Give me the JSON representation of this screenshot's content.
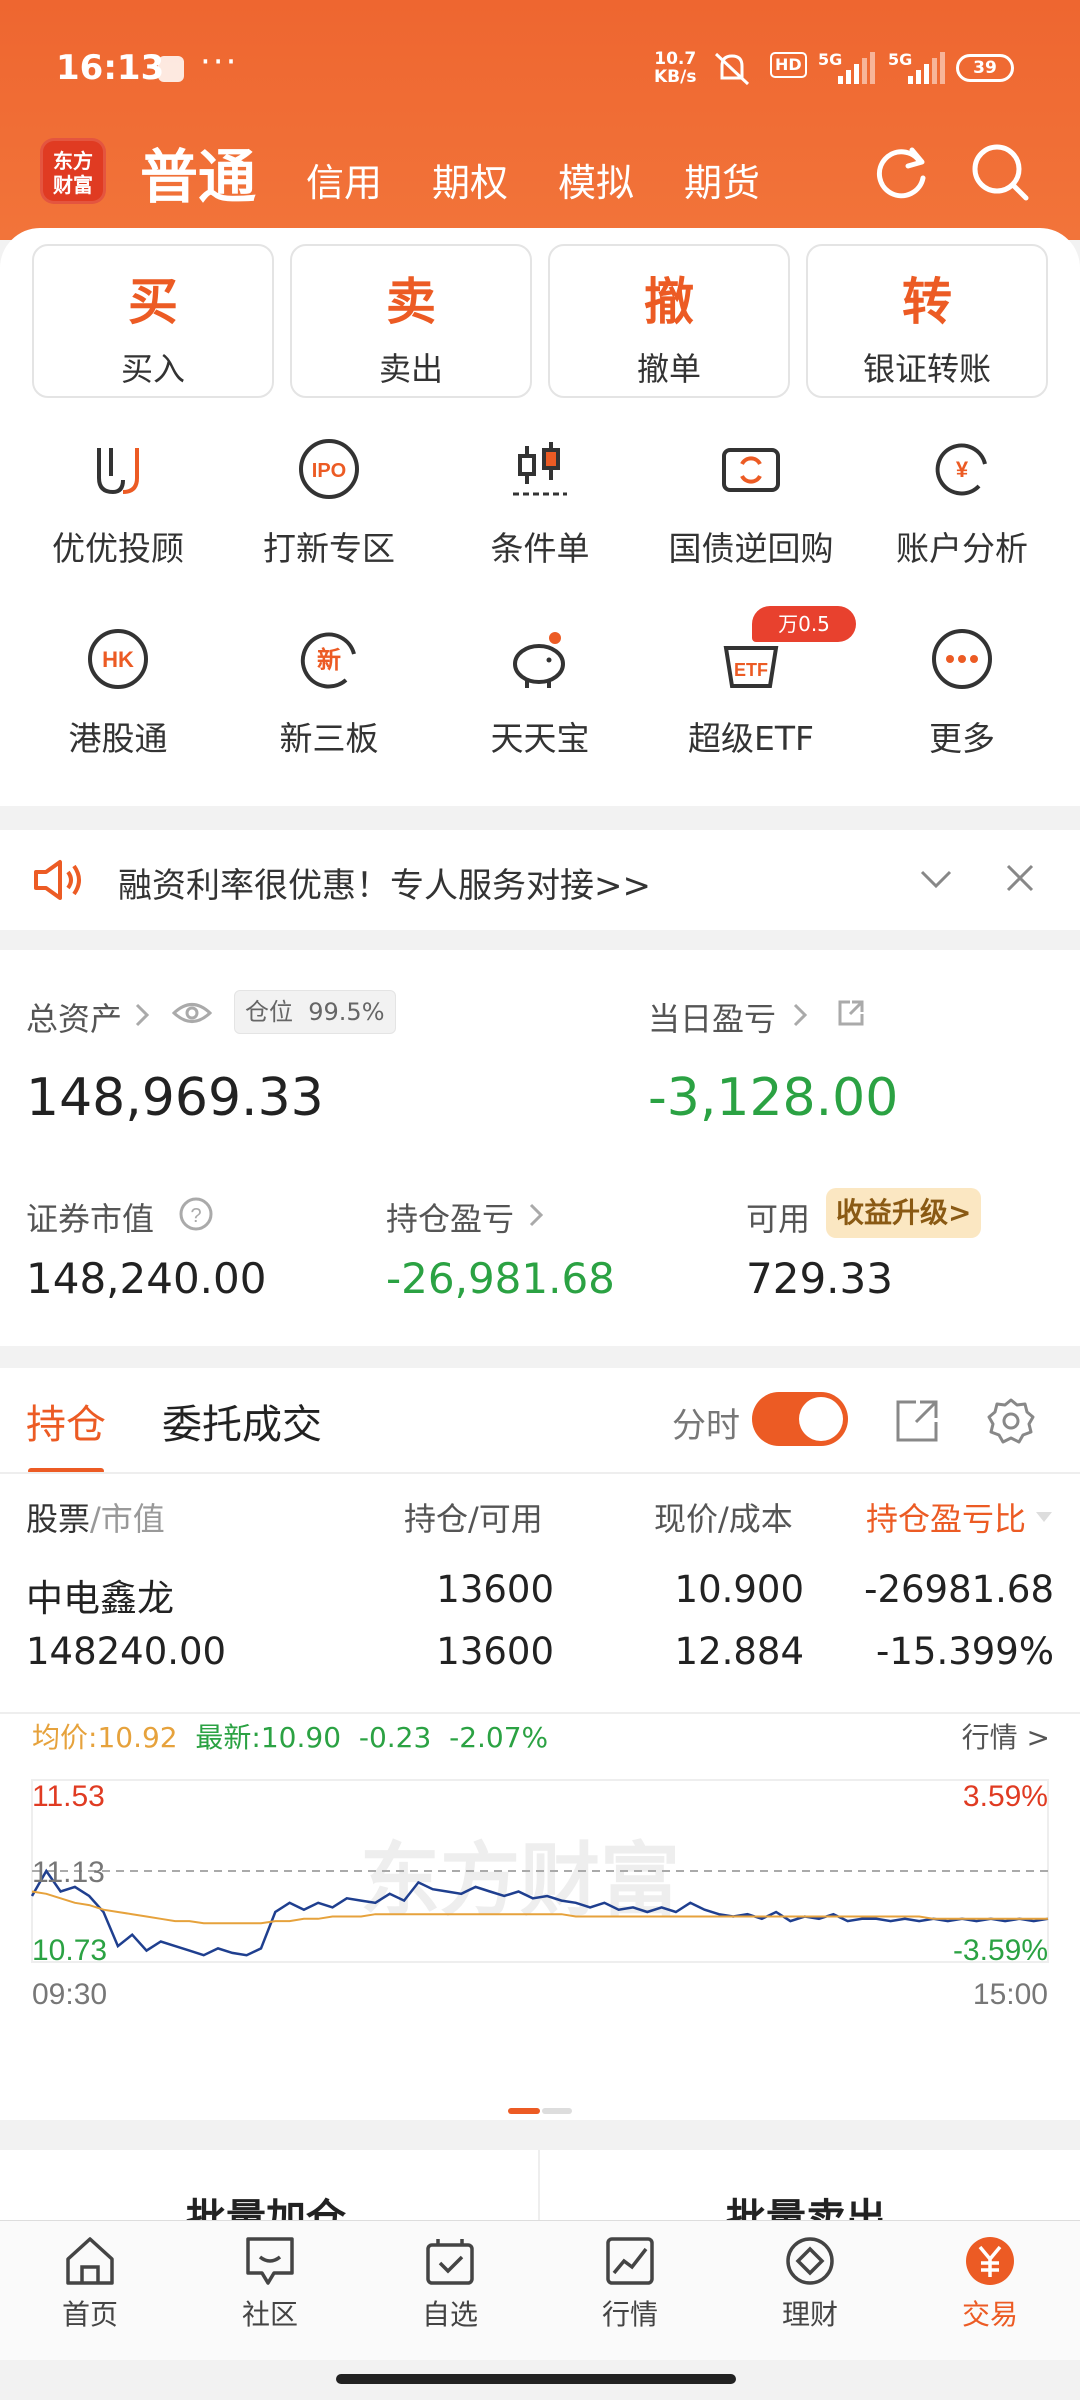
{
  "status_bar": {
    "time": "16:13",
    "net_speed_value": "10.7",
    "net_speed_unit": "KB/s",
    "battery": "39",
    "hd": "HD",
    "sig1": "5G",
    "sig2": "5G"
  },
  "top_nav": {
    "logo_line1": "东方",
    "logo_line2": "财富",
    "active_tab": "普通",
    "tabs": [
      "信用",
      "期权",
      "模拟",
      "期货"
    ]
  },
  "quick_actions": [
    {
      "big": "买",
      "label": "买入"
    },
    {
      "big": "卖",
      "label": "卖出"
    },
    {
      "big": "撤",
      "label": "撤单"
    },
    {
      "big": "转",
      "label": "银证转账"
    }
  ],
  "grid": {
    "row1": [
      "优优投顾",
      "打新专区",
      "条件单",
      "国债逆回购",
      "账户分析"
    ],
    "row2": [
      "港股通",
      "新三板",
      "天天宝",
      "超级ETF",
      "更多"
    ],
    "etf_badge": "万0.5",
    "hk_text": "HK",
    "ipo_text": "IPO",
    "new_text": "新",
    "yen_text": "¥",
    "etf_text": "ETF"
  },
  "notice": {
    "text": "融资利率很优惠！专人服务对接>>"
  },
  "assets": {
    "total_label": "总资产",
    "position_label": "仓位",
    "position_value": "99.5%",
    "total_value": "148,969.33",
    "daily_label": "当日盈亏",
    "daily_value": "-3,128.00",
    "market_label": "证券市值",
    "market_value": "148,240.00",
    "holding_label": "持仓盈亏",
    "holding_value": "-26,981.68",
    "avail_label": "可用",
    "avail_value": "729.33",
    "upgrade_label": "收益升级>"
  },
  "positions": {
    "tab_holding": "持仓",
    "tab_orders": "委托成交",
    "intraday_label": "分时",
    "col_stock": "股票",
    "col_mv": "/市值",
    "col_qty": "持仓/可用",
    "col_price": "现价/成本",
    "col_pnl": "持仓盈亏比",
    "rows": [
      {
        "name": "中电鑫龙",
        "market_value": "148240.00",
        "holding": "13600",
        "available": "13600",
        "price": "10.900",
        "cost": "12.884",
        "pnl": "-26981.68",
        "pnl_pct": "-15.399%"
      }
    ]
  },
  "mini_chart": {
    "avg_label": "均价:",
    "avg_value": "10.92",
    "latest_label": "最新:",
    "latest_value": "10.90",
    "change": "-0.23",
    "change_pct": "-2.07%",
    "market_link": "行情 >",
    "y_high": "11.53",
    "y_mid": "11.13",
    "y_low": "10.73",
    "pct_high": "3.59%",
    "pct_low": "-3.59%",
    "t_start": "09:30",
    "t_end": "15:00",
    "watermark": "东方财富"
  },
  "chart_data": {
    "type": "line",
    "x_label_start": "09:30",
    "x_label_end": "15:00",
    "ylim": [
      10.73,
      11.53
    ],
    "y_reference": 11.13,
    "series": [
      {
        "values": [
          11.02,
          11.13,
          11.04,
          11.06,
          11.02,
          10.95,
          10.8,
          10.85,
          10.78,
          10.82,
          10.8,
          10.78,
          10.76,
          10.79,
          10.77,
          10.76,
          10.79,
          10.95,
          10.99,
          10.96,
          10.99,
          10.97,
          11.01,
          11.0,
          10.99,
          11.03,
          11.0,
          11.08,
          11.05,
          11.04,
          11.03,
          11.06,
          11.04,
          11.02,
          11.04,
          11.01,
          11.02,
          11.0,
          10.99,
          10.97,
          10.99,
          10.96,
          10.97,
          10.95,
          10.97,
          10.95,
          10.99,
          10.96,
          10.94,
          10.93,
          10.94,
          10.92,
          10.95,
          10.91,
          10.93,
          10.92,
          10.94,
          10.91,
          10.92,
          10.92,
          10.91,
          10.92,
          10.91,
          10.92,
          10.91,
          10.92,
          10.91,
          10.92,
          10.91,
          10.92,
          10.91,
          10.92
        ]
      },
      {
        "values": [
          11.04,
          11.03,
          11.01,
          10.99,
          10.98,
          10.96,
          10.95,
          10.94,
          10.93,
          10.92,
          10.91,
          10.91,
          10.9,
          10.9,
          10.9,
          10.9,
          10.9,
          10.91,
          10.91,
          10.92,
          10.92,
          10.93,
          10.93,
          10.93,
          10.94,
          10.94,
          10.94,
          10.94,
          10.94,
          10.94,
          10.94,
          10.94,
          10.94,
          10.94,
          10.94,
          10.94,
          10.94,
          10.94,
          10.93,
          10.93,
          10.93,
          10.93,
          10.93,
          10.93,
          10.93,
          10.93,
          10.93,
          10.93,
          10.93,
          10.93,
          10.93,
          10.93,
          10.93,
          10.93,
          10.93,
          10.93,
          10.93,
          10.93,
          10.93,
          10.93,
          10.93,
          10.93,
          10.93,
          10.92,
          10.92,
          10.92,
          10.92,
          10.92,
          10.92,
          10.92,
          10.92,
          10.92
        ]
      }
    ]
  },
  "batch": {
    "add": "批量加仓",
    "sell": "批量卖出"
  },
  "bottom_nav": [
    "首页",
    "社区",
    "自选",
    "行情",
    "理财",
    "交易"
  ],
  "colors": {
    "brand": "#ec5b24",
    "green": "#2ba243",
    "red": "#e03b22"
  }
}
